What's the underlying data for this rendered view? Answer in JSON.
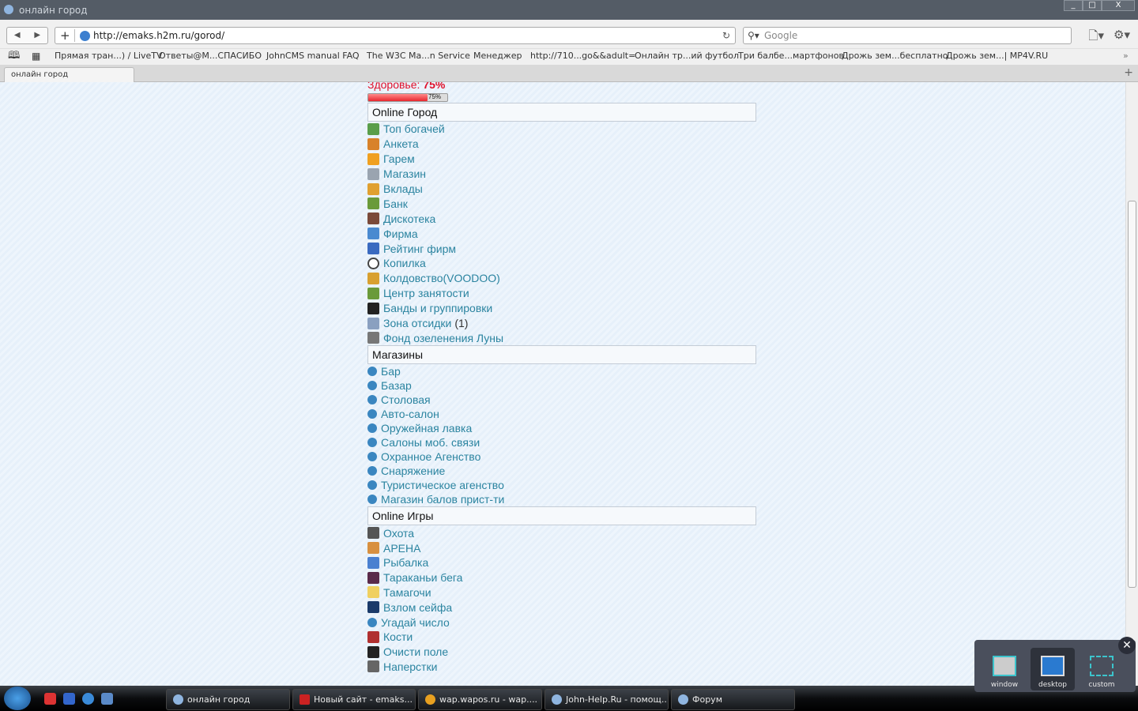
{
  "window": {
    "title": "онлайн город",
    "min": "_",
    "max": "□",
    "close": "X"
  },
  "toolbar": {
    "url": "http://emaks.h2m.ru/gorod/",
    "search_placeholder": "Google",
    "back": "◀",
    "forward": "▶",
    "add": "+",
    "reload": "↻",
    "search_icon": "magnifier-icon",
    "page_icon": "page-icon",
    "settings_icon": "gear-icon"
  },
  "bookmarks": [
    "Прямая тран...) / LiveTV",
    "Ответы@М...СПАСИБО",
    "JohnCMS manual FAQ",
    "The W3C Ma...n Service",
    "Менеджер",
    "http://710...go&&adult=",
    "Онлайн тр...ий футбол",
    "Три балбе...мартфонов",
    "Дрожь зем...бесплатно",
    "Дрожь зем...| MP4V.RU"
  ],
  "tabs": [
    {
      "label": "онлайн город",
      "active": true
    }
  ],
  "page": {
    "health_label": "Здоровье:",
    "health_value": "75%",
    "health_percent": 75,
    "bar_label": "75%",
    "sections": [
      {
        "title": "Online Город",
        "items": [
          {
            "label": "Топ богачей",
            "color": "#5a9e4a"
          },
          {
            "label": "Анкета",
            "color": "#d8822a"
          },
          {
            "label": "Гарем",
            "color": "#f0a020"
          },
          {
            "label": "Магазин",
            "color": "#9aa4b0"
          },
          {
            "label": "Вклады",
            "color": "#e0a030"
          },
          {
            "label": "Банк",
            "color": "#6a9a3a"
          },
          {
            "label": "Дискотека",
            "color": "#7a4a3a"
          },
          {
            "label": "Фирма",
            "color": "#4a8ad0"
          },
          {
            "label": "Рейтинг фирм",
            "color": "#3a6ac0"
          },
          {
            "label": "Копилка",
            "color": "#ffffff"
          },
          {
            "label": "Колдовство(VOODOO)",
            "color": "#d8a030"
          },
          {
            "label": "Центр занятости",
            "color": "#6a9a3a"
          },
          {
            "label": "Банды и группировки",
            "color": "#222222"
          },
          {
            "label": "Зона отсидки",
            "count": "(1)",
            "color": "#8aa0c0"
          },
          {
            "label": "Фонд озеленения Луны",
            "color": "#777777"
          }
        ]
      },
      {
        "title": "Магазины",
        "items": [
          {
            "label": "Бар"
          },
          {
            "label": "Базар"
          },
          {
            "label": "Столовая"
          },
          {
            "label": "Авто-салон"
          },
          {
            "label": "Оружейная лавка"
          },
          {
            "label": "Салоны моб. связи"
          },
          {
            "label": "Охранное Агенство"
          },
          {
            "label": "Снаряжение"
          },
          {
            "label": "Туристическое агенство"
          },
          {
            "label": "Магазин балов прист-ти"
          }
        ]
      },
      {
        "title": "Online Игры",
        "items": [
          {
            "label": "Охота",
            "color": "#555555"
          },
          {
            "label": "АРЕНА",
            "color": "#d89040"
          },
          {
            "label": "Рыбалка",
            "color": "#4a80d0"
          },
          {
            "label": "Тараканьи бега",
            "color": "#5a2a4a"
          },
          {
            "label": "Тамагочи",
            "color": "#f0d060"
          },
          {
            "label": "Взлом сейфа",
            "color": "#1a3a6a"
          },
          {
            "label": "Угадай число",
            "color": "#3a86c0",
            "bullet": true
          },
          {
            "label": "Кости",
            "color": "#b03030"
          },
          {
            "label": "Очисти поле",
            "color": "#222222"
          },
          {
            "label": "Наперстки",
            "color": "#666666"
          }
        ]
      }
    ]
  },
  "taskbar": {
    "items": [
      "онлайн город",
      "Новый сайт - emaks...",
      "wap.wapos.ru - wap....",
      "John-Help.Ru - помощ...",
      "Форум"
    ]
  },
  "capture_panel": {
    "options": [
      "window",
      "desktop",
      "custom"
    ],
    "selected": "desktop",
    "close": "✕"
  }
}
